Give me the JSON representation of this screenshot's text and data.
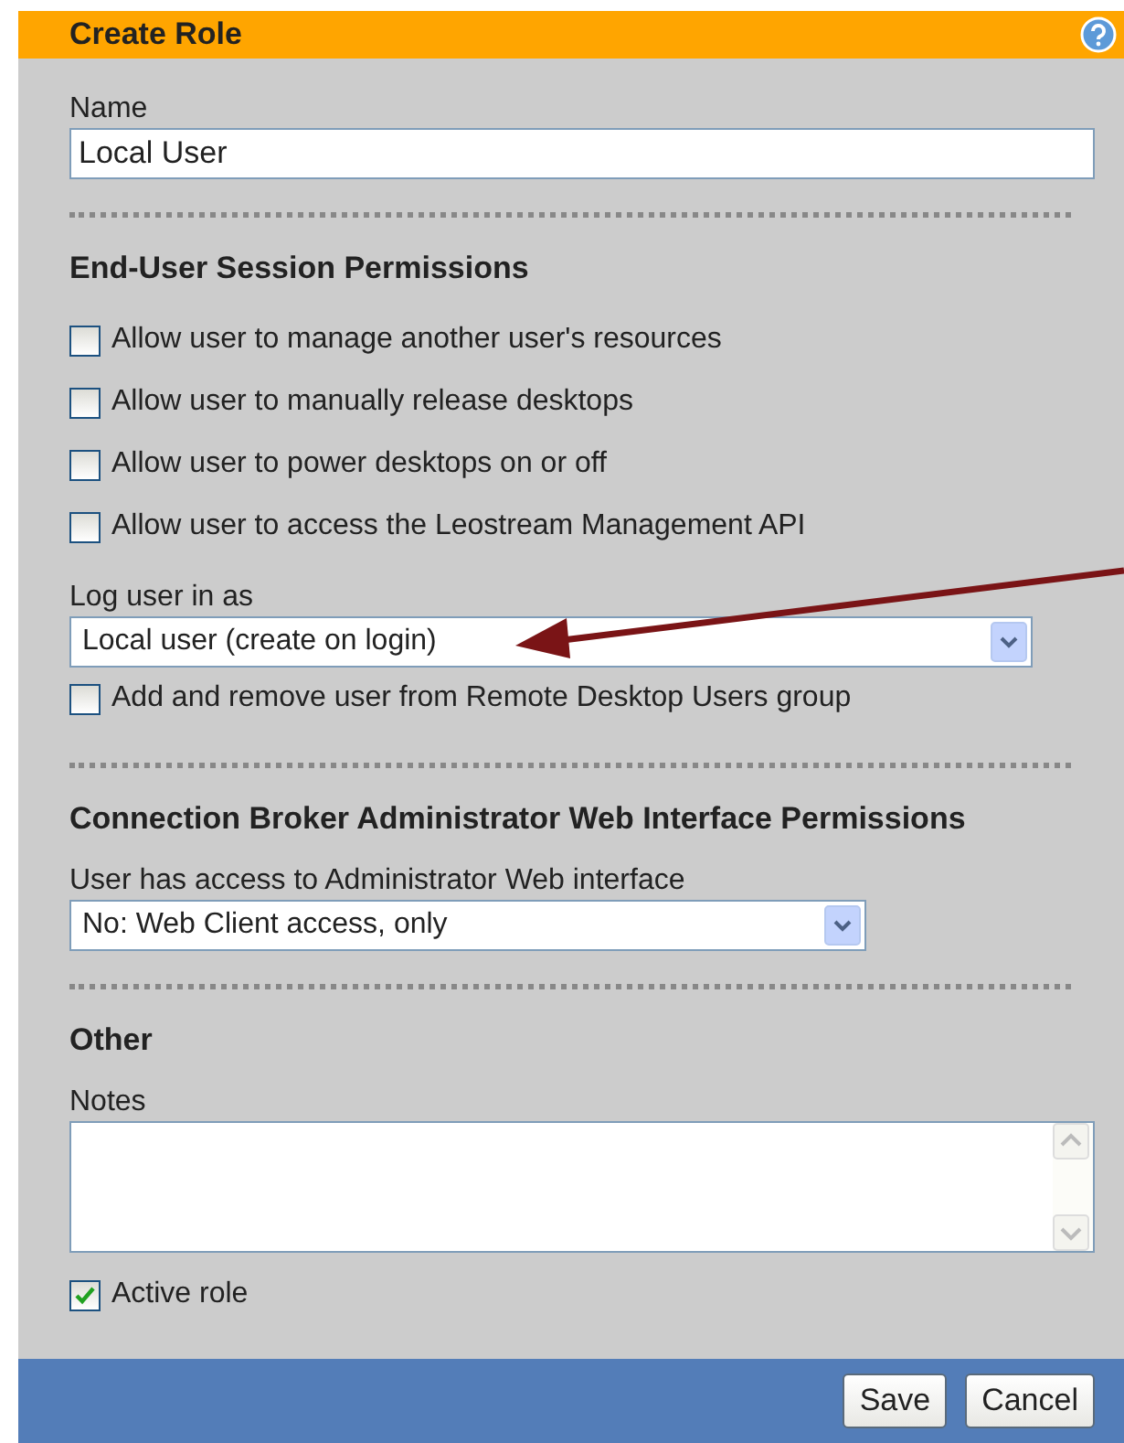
{
  "title": "Create Role",
  "items": [
    {
      "kind": "text_field",
      "label": "Name",
      "value": "Local User"
    },
    {
      "kind": "divider"
    },
    {
      "kind": "heading",
      "text": "End-User Session Permissions"
    },
    {
      "kind": "checkbox",
      "label": "Allow user to manage another user's resources",
      "checked": false
    },
    {
      "kind": "checkbox",
      "label": "Allow user to manually release desktops",
      "checked": false
    },
    {
      "kind": "checkbox",
      "label": "Allow user to power desktops on or off",
      "checked": false
    },
    {
      "kind": "checkbox",
      "label": "Allow user to access the Leostream Management API",
      "checked": false
    },
    {
      "kind": "select",
      "label": "Log user in as",
      "value": "Local user (create on login)"
    },
    {
      "kind": "checkbox",
      "label": "Add and remove user from Remote Desktop Users group",
      "checked": false
    },
    {
      "kind": "divider"
    },
    {
      "kind": "heading",
      "text": "Connection Broker Administrator Web Interface Permissions"
    },
    {
      "kind": "select",
      "label": "User has access to Administrator Web interface",
      "value": "No: Web Client access, only"
    },
    {
      "kind": "divider"
    },
    {
      "kind": "heading",
      "text": "Other"
    },
    {
      "kind": "textarea",
      "label": "Notes"
    },
    {
      "kind": "checkbox",
      "label": "Active role",
      "checked": true
    }
  ],
  "buttons": [
    "Save",
    "Cancel"
  ]
}
